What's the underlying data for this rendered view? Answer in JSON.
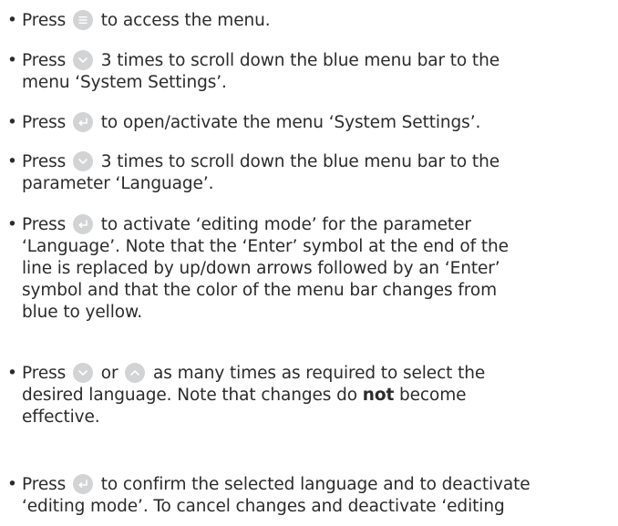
{
  "steps": [
    {
      "segments": [
        "Press ",
        " to access the menu."
      ]
    },
    {
      "segments": [
        "Press ",
        " 3 times to scroll down the blue menu bar to the",
        "menu ‘System Settings’."
      ]
    },
    {
      "segments": [
        "Press ",
        " to open/activate the menu ‘System Settings’."
      ]
    },
    {
      "segments": [
        "Press ",
        " 3 times to scroll down the blue menu bar to the",
        "parameter ‘Language’."
      ]
    },
    {
      "segments": [
        "Press ",
        " to activate ‘editing mode’ for the parameter",
        "‘Language’. Note that the ‘Enter’ symbol at the end of the",
        "line is replaced by up/down arrows followed by an ‘Enter’",
        "symbol and that the color of the menu bar changes from",
        "blue to yellow."
      ]
    },
    {
      "segments": [
        "Press ",
        " or ",
        " as many times as required to select the",
        "desired language. Note that changes do ",
        "not",
        " become",
        "effective."
      ]
    },
    {
      "segments": [
        "Press ",
        " to confirm the selected language and to deactivate",
        "‘editing mode’. To cancel changes and deactivate ‘editing"
      ]
    }
  ],
  "bullet": "•",
  "icons": {
    "menu": "menu-icon",
    "down": "arrow-down-icon",
    "up": "arrow-up-icon",
    "enter": "enter-icon"
  }
}
